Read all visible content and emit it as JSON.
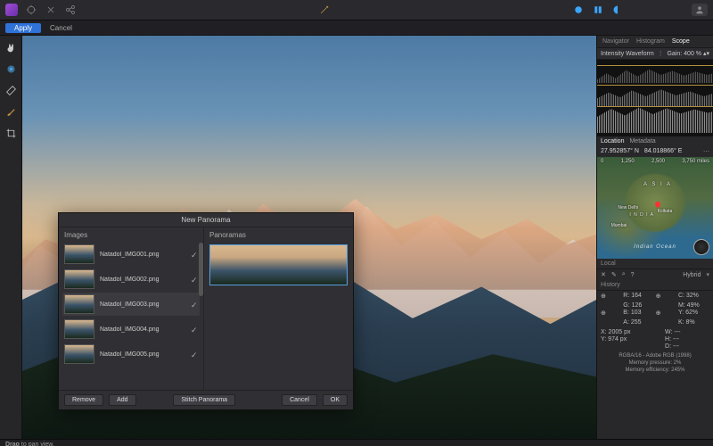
{
  "actionbar": {
    "apply": "Apply",
    "cancel": "Cancel"
  },
  "dialog": {
    "title": "New Panorama",
    "images_header": "Images",
    "panoramas_header": "Panoramas",
    "items": [
      {
        "name": "Natadol_IMG001.png"
      },
      {
        "name": "Natadol_IMG002.png"
      },
      {
        "name": "Natadol_IMG003.png"
      },
      {
        "name": "Natadol_IMG004.png"
      },
      {
        "name": "Natadol_IMG005.png"
      }
    ],
    "selected_index": 2,
    "buttons": {
      "remove": "Remove",
      "add": "Add",
      "stitch": "Stitch Panorama",
      "cancel": "Cancel",
      "ok": "OK"
    }
  },
  "right": {
    "tabs": {
      "navigator": "Navigator",
      "histogram": "Histogram",
      "scope": "Scope",
      "active": "Scope"
    },
    "scope": {
      "title": "Intensity Waveform",
      "gain_label": "Gain:",
      "gain_value": "400 %"
    },
    "loc_tabs": {
      "location": "Location",
      "metadata": "Metadata"
    },
    "coords": {
      "lat": "27.952857° N",
      "lon": "84.018866° E"
    },
    "scale": {
      "a": "0",
      "b": "1,250",
      "c": "2,500",
      "d": "3,750 miles"
    },
    "map": {
      "asia": "A S I A",
      "india": "I N D I A",
      "ocean": "Indian Ocean",
      "city1": "New Delhi",
      "city2": "Kolkata",
      "city3": "Mumbai"
    },
    "local_label": "Local",
    "toolrow": {
      "hybrid": "Hybrid"
    },
    "colorinfo": {
      "R": "R:",
      "Rv": "164",
      "G": "G:",
      "Gv": "126",
      "B": "B:",
      "Bv": "103",
      "A": "A:",
      "Av": "255",
      "C": "C:",
      "Cv": "32%",
      "M": "M:",
      "Mv": "49%",
      "Y": "Y:",
      "Yv": "62%",
      "K": "K:",
      "Kv": "8%"
    },
    "pos": {
      "X": "X: 2005 px",
      "Y": "Y: 974 px",
      "W": "W: ---",
      "H": "H: ---",
      "D": "D: ---"
    },
    "meta": {
      "line1": "RGBA/16 - Adobe RGB (1998)",
      "line2": "Memory pressure: 2%",
      "line3": "Memory efficiency: 245%"
    },
    "history": "History"
  },
  "status": {
    "hint": "Drag to pan view."
  },
  "icons": {
    "hand": "hand",
    "wand": "wand",
    "brush": "brush",
    "crop": "crop",
    "gear": "gear",
    "share": "share",
    "link": "link",
    "shape": "shape"
  }
}
